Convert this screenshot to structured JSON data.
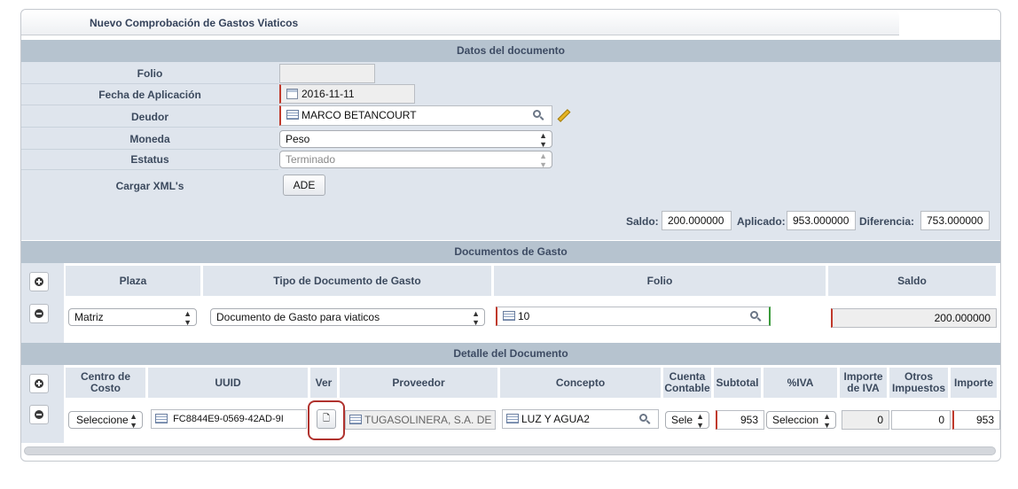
{
  "window": {
    "title": "Nuevo Comprobación de Gastos Viaticos"
  },
  "sections": {
    "datos": "Datos del documento",
    "gasto": "Documentos de Gasto",
    "detalle": "Detalle del Documento"
  },
  "form": {
    "folio": {
      "label": "Folio",
      "value": ""
    },
    "fecha": {
      "label": "Fecha de Aplicación",
      "value": "2016-11-11"
    },
    "deudor": {
      "label": "Deudor",
      "value": "MARCO BETANCOURT"
    },
    "moneda": {
      "label": "Moneda",
      "value": "Peso"
    },
    "estatus": {
      "label": "Estatus",
      "value": "Terminado"
    },
    "xml": {
      "label": "Cargar XML's",
      "button": "ADE"
    }
  },
  "totals": {
    "saldo_label": "Saldo:",
    "saldo": "200.000000",
    "aplicado_label": "Aplicado:",
    "aplicado": "953.000000",
    "diferencia_label": "Diferencia:",
    "diferencia": "753.000000"
  },
  "gasto_table": {
    "headers": {
      "plaza": "Plaza",
      "tipo": "Tipo de Documento de Gasto",
      "folio": "Folio",
      "saldo": "Saldo"
    },
    "row": {
      "plaza": "Matriz",
      "tipo": "Documento de Gasto para viaticos",
      "folio": "10",
      "saldo": "200.000000"
    }
  },
  "detalle_table": {
    "headers": {
      "centro_line1": "Centro de",
      "centro_line2": "Costo",
      "uuid": "UUID",
      "ver": "Ver",
      "proveedor": "Proveedor",
      "concepto": "Concepto",
      "cuenta_line1": "Cuenta",
      "cuenta_line2": "Contable",
      "subtotal": "Subtotal",
      "iva": "%IVA",
      "importe_iva_line1": "Importe",
      "importe_iva_line2": "de IVA",
      "otros_line1": "Otros",
      "otros_line2": "Impuestos",
      "importe": "Importe"
    },
    "row": {
      "centro": "Seleccione",
      "uuid": "FC8844E9-0569-42AD-9I",
      "proveedor": "TUGASOLINERA, S.A. DE",
      "concepto": "LUZ Y AGUA2",
      "cuenta": "Sele",
      "subtotal": "953",
      "iva": "Seleccion",
      "importe_iva": "0",
      "otros": "0",
      "importe": "953"
    }
  },
  "icons": {
    "add": "plus-circle-icon",
    "remove": "minus-circle-icon",
    "calendar": "calendar-icon",
    "list": "list-icon",
    "search": "magnifier-icon",
    "edit": "pencil-icon",
    "view": "document-icon"
  },
  "colors": {
    "section_header": "#b6c3cf",
    "row_bg": "#dfe5ed",
    "required": "#c0392b",
    "highlight": "#b0322e"
  }
}
